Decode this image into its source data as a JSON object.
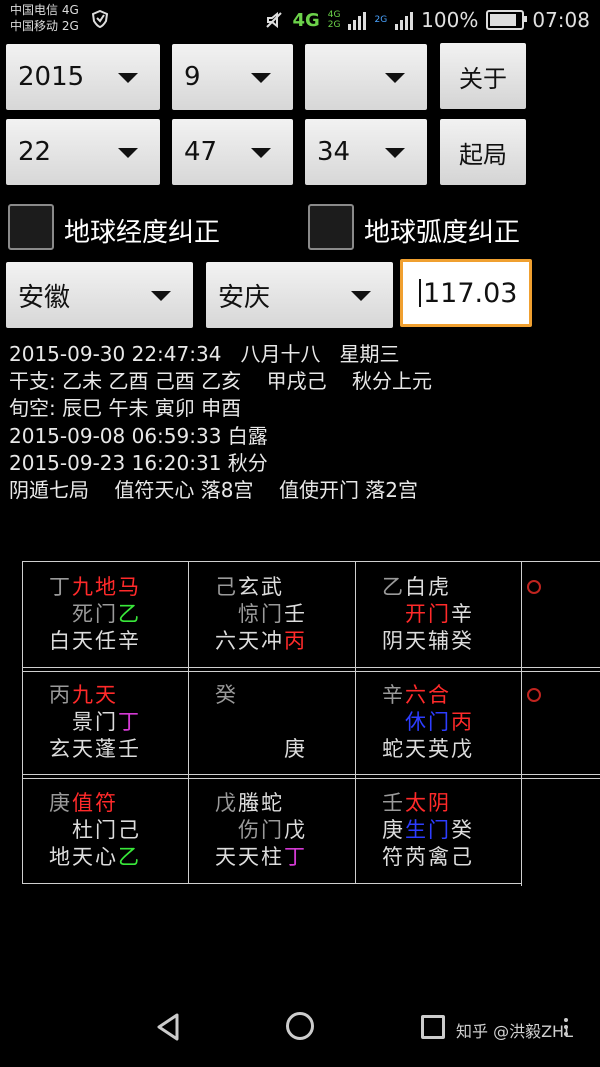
{
  "status_bar": {
    "carrier1": "中国电信 4G",
    "carrier2": "中国移动 2G",
    "network": "4G",
    "sub_network_top": "4G",
    "sub_network_bottom": "2G",
    "sub_network_2g": "2G",
    "battery": "100%",
    "battery_level": 1.0,
    "time": "07:08",
    "icons": [
      "shield-icon",
      "mute-icon",
      "signal-icon",
      "battery-icon"
    ]
  },
  "date_row": {
    "year": "2015",
    "month": "9",
    "day": "",
    "about_button": "关于"
  },
  "time_row": {
    "hour": "22",
    "minute": "47",
    "second": "34",
    "start_button": "起局"
  },
  "checkboxes": {
    "longitude_label": "地球经度纠正",
    "longitude_checked": false,
    "radian_label": "地球弧度纠正",
    "radian_checked": false
  },
  "location": {
    "province": "安徽",
    "city": "安庆",
    "longitude_value": "117.03"
  },
  "info_lines": [
    "2015-09-30 22:47:34   八月十八   星期三",
    "干支: 乙未 乙酉 己酉 乙亥    甲戌己    秋分上元",
    "旬空: 辰巳 午未 寅卯 申酉",
    "2015-09-08 06:59:33 白露",
    "2015-09-23 16:20:31 秋分",
    "阴遁七局    值符天心 落8宫    值使开门 落2宫"
  ],
  "palace_grid": [
    [
      {
        "rows": [
          [
            {
              "t": "丁",
              "c": "gry"
            },
            {
              "t": "九",
              "c": "red"
            },
            {
              "t": "地",
              "c": "red"
            },
            {
              "t": "马",
              "c": "red"
            }
          ],
          [
            {
              "t": " ",
              "c": "wht"
            },
            {
              "t": "死",
              "c": "gry"
            },
            {
              "t": "门",
              "c": "gry"
            },
            {
              "t": "乙",
              "c": "grn"
            }
          ],
          [
            {
              "t": "白",
              "c": "wht"
            },
            {
              "t": "天",
              "c": "wht"
            },
            {
              "t": "任",
              "c": "wht"
            },
            {
              "t": "辛",
              "c": "wht"
            }
          ]
        ],
        "ring": false
      },
      {
        "rows": [
          [
            {
              "t": "己",
              "c": "gry"
            },
            {
              "t": "玄",
              "c": "wht"
            },
            {
              "t": "武",
              "c": "wht"
            },
            {
              "t": " ",
              "c": "wht"
            }
          ],
          [
            {
              "t": " ",
              "c": "wht"
            },
            {
              "t": "惊",
              "c": "gry"
            },
            {
              "t": "门",
              "c": "gry"
            },
            {
              "t": "壬",
              "c": "wht"
            }
          ],
          [
            {
              "t": "六",
              "c": "wht"
            },
            {
              "t": "天",
              "c": "wht"
            },
            {
              "t": "冲",
              "c": "wht"
            },
            {
              "t": "丙",
              "c": "red"
            }
          ]
        ],
        "ring": false
      },
      {
        "rows": [
          [
            {
              "t": "乙",
              "c": "gry"
            },
            {
              "t": "白",
              "c": "wht"
            },
            {
              "t": "虎",
              "c": "wht"
            },
            {
              "t": " ",
              "c": "wht"
            }
          ],
          [
            {
              "t": " ",
              "c": "wht"
            },
            {
              "t": "开",
              "c": "red"
            },
            {
              "t": "门",
              "c": "red"
            },
            {
              "t": "辛",
              "c": "wht"
            }
          ],
          [
            {
              "t": "阴",
              "c": "wht"
            },
            {
              "t": "天",
              "c": "wht"
            },
            {
              "t": "辅",
              "c": "wht"
            },
            {
              "t": "癸",
              "c": "wht"
            }
          ]
        ],
        "ring": true
      }
    ],
    [
      {
        "rows": [
          [
            {
              "t": "丙",
              "c": "gry"
            },
            {
              "t": "九",
              "c": "red"
            },
            {
              "t": "天",
              "c": "red"
            },
            {
              "t": " ",
              "c": "wht"
            }
          ],
          [
            {
              "t": " ",
              "c": "wht"
            },
            {
              "t": "景",
              "c": "wht"
            },
            {
              "t": "门",
              "c": "wht"
            },
            {
              "t": "丁",
              "c": "mag"
            }
          ],
          [
            {
              "t": "玄",
              "c": "wht"
            },
            {
              "t": "天",
              "c": "wht"
            },
            {
              "t": "蓬",
              "c": "wht"
            },
            {
              "t": "壬",
              "c": "wht"
            }
          ]
        ],
        "ring": false
      },
      {
        "rows": [
          [
            {
              "t": "癸",
              "c": "gry"
            },
            {
              "t": " ",
              "c": "wht"
            },
            {
              "t": " ",
              "c": "wht"
            },
            {
              "t": " ",
              "c": "wht"
            }
          ],
          [
            {
              "t": " ",
              "c": "wht"
            },
            {
              "t": " ",
              "c": "wht"
            },
            {
              "t": " ",
              "c": "wht"
            },
            {
              "t": " ",
              "c": "wht"
            }
          ],
          [
            {
              "t": " ",
              "c": "wht"
            },
            {
              "t": " ",
              "c": "wht"
            },
            {
              "t": " ",
              "c": "wht"
            },
            {
              "t": "庚",
              "c": "wht"
            }
          ]
        ],
        "ring": false
      },
      {
        "rows": [
          [
            {
              "t": "辛",
              "c": "gry"
            },
            {
              "t": "六",
              "c": "red"
            },
            {
              "t": "合",
              "c": "red"
            },
            {
              "t": " ",
              "c": "wht"
            }
          ],
          [
            {
              "t": " ",
              "c": "wht"
            },
            {
              "t": "休",
              "c": "blu"
            },
            {
              "t": "门",
              "c": "blu"
            },
            {
              "t": "丙",
              "c": "red"
            }
          ],
          [
            {
              "t": "蛇",
              "c": "wht"
            },
            {
              "t": "天",
              "c": "wht"
            },
            {
              "t": "英",
              "c": "wht"
            },
            {
              "t": "戊",
              "c": "wht"
            }
          ]
        ],
        "ring": true
      }
    ],
    [
      {
        "rows": [
          [
            {
              "t": "庚",
              "c": "gry"
            },
            {
              "t": "值",
              "c": "red"
            },
            {
              "t": "符",
              "c": "red"
            },
            {
              "t": " ",
              "c": "wht"
            }
          ],
          [
            {
              "t": " ",
              "c": "wht"
            },
            {
              "t": "杜",
              "c": "wht"
            },
            {
              "t": "门",
              "c": "wht"
            },
            {
              "t": "己",
              "c": "wht"
            }
          ],
          [
            {
              "t": "地",
              "c": "wht"
            },
            {
              "t": "天",
              "c": "wht"
            },
            {
              "t": "心",
              "c": "wht"
            },
            {
              "t": "乙",
              "c": "grn"
            }
          ]
        ],
        "ring": false
      },
      {
        "rows": [
          [
            {
              "t": "戊",
              "c": "gry"
            },
            {
              "t": "螣",
              "c": "wht"
            },
            {
              "t": "蛇",
              "c": "wht"
            },
            {
              "t": " ",
              "c": "wht"
            }
          ],
          [
            {
              "t": " ",
              "c": "wht"
            },
            {
              "t": "伤",
              "c": "gry"
            },
            {
              "t": "门",
              "c": "gry"
            },
            {
              "t": "戊",
              "c": "wht"
            }
          ],
          [
            {
              "t": "天",
              "c": "wht"
            },
            {
              "t": "天",
              "c": "wht"
            },
            {
              "t": "柱",
              "c": "wht"
            },
            {
              "t": "丁",
              "c": "mag"
            }
          ]
        ],
        "ring": false
      },
      {
        "rows": [
          [
            {
              "t": "壬",
              "c": "gry"
            },
            {
              "t": "太",
              "c": "red"
            },
            {
              "t": "阴",
              "c": "red"
            },
            {
              "t": " ",
              "c": "wht"
            }
          ],
          [
            {
              "t": "庚",
              "c": "wht"
            },
            {
              "t": "生",
              "c": "blu"
            },
            {
              "t": "门",
              "c": "blu"
            },
            {
              "t": "癸",
              "c": "wht"
            }
          ],
          [
            {
              "t": "符",
              "c": "wht"
            },
            {
              "t": "芮",
              "c": "wht"
            },
            {
              "t": "禽",
              "c": "wht"
            },
            {
              "t": "己",
              "c": "wht"
            }
          ]
        ],
        "ring": false
      }
    ]
  ],
  "nav_bar": {
    "watermark": "知乎 @洪毅ZHL",
    "icons": [
      "back-icon",
      "home-icon",
      "recent-apps-icon",
      "more-icon"
    ]
  },
  "colors": {
    "accent_focus": "#f0a030",
    "red": "#ff2a2a",
    "green": "#39e83a",
    "magenta": "#d43ad4",
    "blue": "#2d3dff"
  }
}
